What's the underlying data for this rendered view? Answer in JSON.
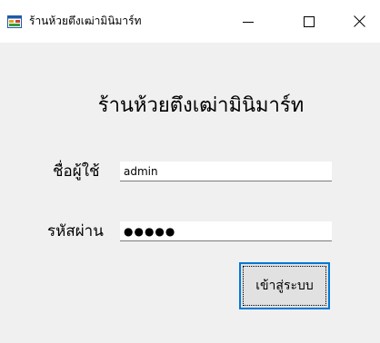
{
  "window": {
    "title": "ร้านห้วยตึงเฒ่ามินิมาร์ท",
    "icon": "form-icon",
    "controls": {
      "minimize": "—",
      "maximize": "☐",
      "close": "✕"
    }
  },
  "form": {
    "heading": "ร้านห้วยตึงเฒ่ามินิมาร์ท",
    "username_label": "ชื่อผู้ใช้",
    "username_value": "admin",
    "password_label": "รหัสผ่าน",
    "password_mask": "●●●●●",
    "login_button": "เข้าสู่ระบบ"
  },
  "colors": {
    "window_bg": "#f0f0f0",
    "titlebar_bg": "#ffffff",
    "button_border": "#0078d7",
    "button_bg": "#e1e1e1"
  }
}
